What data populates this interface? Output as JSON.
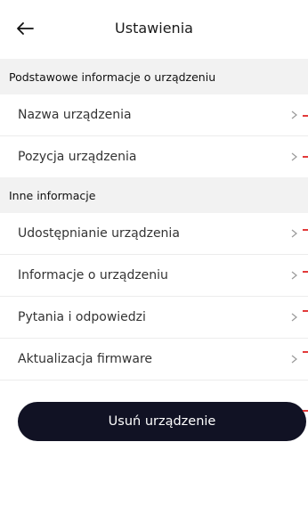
{
  "header": {
    "title": "Ustawienia"
  },
  "sections": [
    {
      "header": "Podstawowe informacje o urządzeniu",
      "items": [
        {
          "label": "Nazwa urządzenia"
        },
        {
          "label": "Pozycja urządzenia"
        }
      ]
    },
    {
      "header": "Inne informacje",
      "items": [
        {
          "label": "Udostępnianie urządzenia"
        },
        {
          "label": "Informacje o urządzeniu"
        },
        {
          "label": "Pytania i odpowiedzi"
        },
        {
          "label": "Aktualizacja firmware"
        }
      ]
    }
  ],
  "actions": {
    "delete_label": "Usuń urządzenie"
  },
  "colors": {
    "button_bg": "#111224",
    "section_bg": "#f2f2f2",
    "marker": "#e23a3a"
  }
}
